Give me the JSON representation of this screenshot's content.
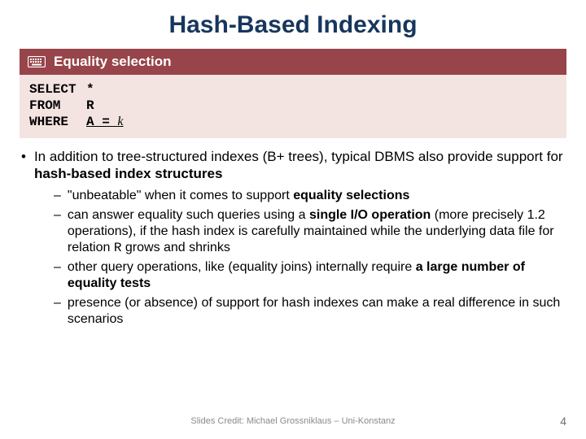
{
  "title": "Hash-Based Indexing",
  "banner": {
    "icon": "keyboard-icon",
    "label": "Equality selection"
  },
  "code": {
    "l1k": "SELECT",
    "l1r": "*",
    "l2k": "FROM",
    "l2r": "R",
    "l3k": "WHERE",
    "l3a": "A = ",
    "l3b": "k"
  },
  "point": {
    "pre": "In addition to tree-structured indexes (B+ trees), typical DBMS also provide support for ",
    "bold": "hash-based index structures"
  },
  "subs": {
    "a": {
      "pre": "\"unbeatable\" when it comes to support ",
      "bold": "equality selections"
    },
    "b": {
      "pre": "can answer equality such queries using a ",
      "bold": "single I/O operation",
      "mid": " (more precisely 1.2 operations), if the hash index is carefully maintained while the underlying data file for relation ",
      "rel": "R",
      "post": " grows and shrinks"
    },
    "c": {
      "pre": "other query operations, like (equality joins) internally require ",
      "bold": "a large number of equality tests"
    },
    "d": {
      "text": "presence (or absence) of support for hash indexes can make a real difference in such scenarios"
    }
  },
  "footer": "Slides Credit: Michael Grossniklaus – Uni-Konstanz",
  "pagenum": "4"
}
